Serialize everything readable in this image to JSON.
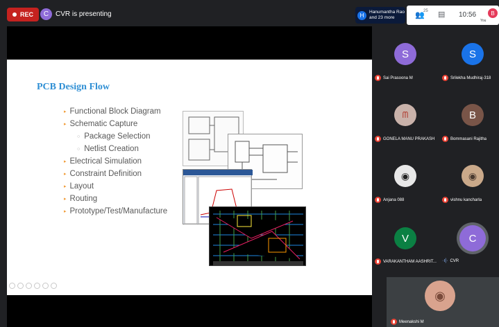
{
  "topbar": {
    "rec_label": "REC",
    "presenter_initial": "C",
    "presenting_text": "CVR is presenting",
    "participants_initial": "H",
    "participants_line1": "Hanumantha Rao",
    "participants_line2": "and 23 more",
    "people_count": "25",
    "time": "10:56",
    "self_initial": "B",
    "self_label": "You"
  },
  "slide": {
    "title": "PCB Design Flow",
    "bullets": [
      "Functional Block Diagram",
      "Schematic Capture",
      "Package Selection",
      "Netlist Creation",
      "Electrical Simulation",
      "Constraint Definition",
      "Layout",
      "Routing",
      "Prototype/Test/Manufacture"
    ]
  },
  "tiles": [
    {
      "name": "Sai Prasoona M",
      "initial": "S",
      "color": "#8e6bd8"
    },
    {
      "name": "Srilekha Mudhiraj-318",
      "initial": "S",
      "color": "#1a73e8"
    },
    {
      "name": "GONELA MANU PRAKASH",
      "initial": "",
      "color": "#c9b2aa"
    },
    {
      "name": "Bommasani Rajitha",
      "initial": "B",
      "color": "#795548"
    },
    {
      "name": "Anjana 088",
      "initial": "",
      "color": "#e8e8e8"
    },
    {
      "name": "vishnu kancharla",
      "initial": "",
      "color": "#caa98a"
    },
    {
      "name": "VARAKANTHAM AASHRIT...",
      "initial": "V",
      "color": "#0b8043"
    },
    {
      "name": "CVR",
      "initial": "C",
      "color": "#8e6bd8"
    },
    {
      "name": "Meenakshi M",
      "initial": "",
      "color": "#d9a38e"
    }
  ]
}
